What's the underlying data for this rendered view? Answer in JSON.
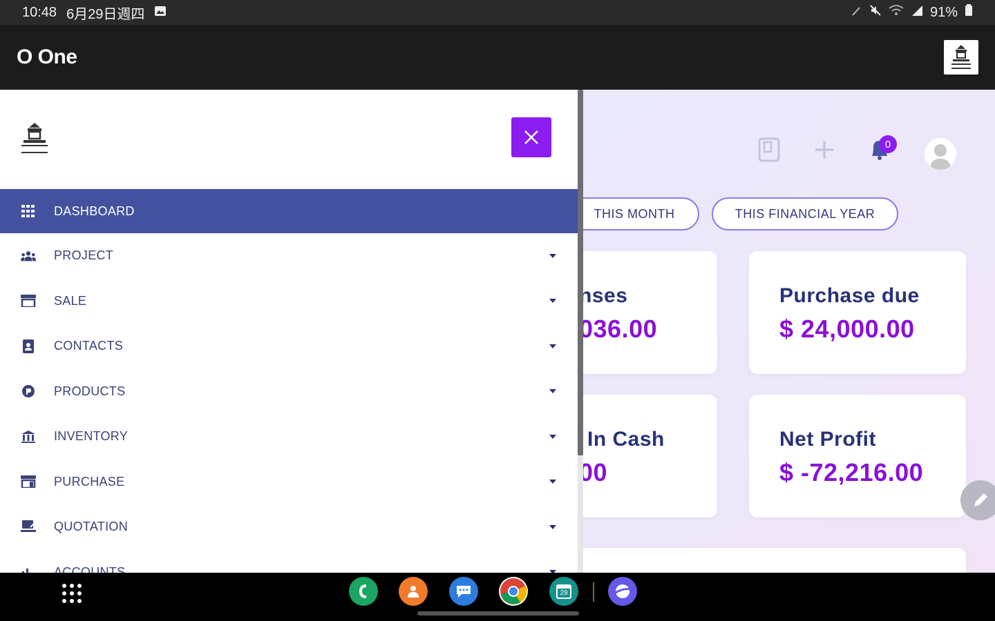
{
  "status_bar": {
    "time": "10:48",
    "date": "6月29日週四",
    "battery": "91%"
  },
  "app_bar": {
    "title": "O One"
  },
  "header": {
    "notification_count": "0"
  },
  "filters": [
    {
      "label": "THIS MONTH"
    },
    {
      "label": "THIS FINANCIAL YEAR"
    }
  ],
  "cards": [
    {
      "title": "nses",
      "value": "036.00"
    },
    {
      "title": "Purchase due",
      "value": "$ 24,000.00"
    },
    {
      "title": "In Cash",
      "value": "00"
    },
    {
      "title": "Net Profit",
      "value": "$ -72,216.00"
    }
  ],
  "drawer": {
    "menu": [
      {
        "label": "DASHBOARD",
        "icon": "grid-icon",
        "active": true
      },
      {
        "label": "PROJECT",
        "icon": "users-icon"
      },
      {
        "label": "SALE",
        "icon": "store-icon"
      },
      {
        "label": "CONTACTS",
        "icon": "address-book-icon"
      },
      {
        "label": "PRODUCTS",
        "icon": "product-icon"
      },
      {
        "label": "INVENTORY",
        "icon": "warehouse-icon"
      },
      {
        "label": "PURCHASE",
        "icon": "shop-icon"
      },
      {
        "label": "QUOTATION",
        "icon": "quotation-icon"
      },
      {
        "label": "ACCOUNTS",
        "icon": "chart-icon"
      }
    ]
  },
  "dock": {
    "calendar_day": "29"
  },
  "colors": {
    "accent_purple": "#8c1df0",
    "active_menu": "#43519e",
    "value_purple": "#8a10d8",
    "title_navy": "#283278"
  }
}
